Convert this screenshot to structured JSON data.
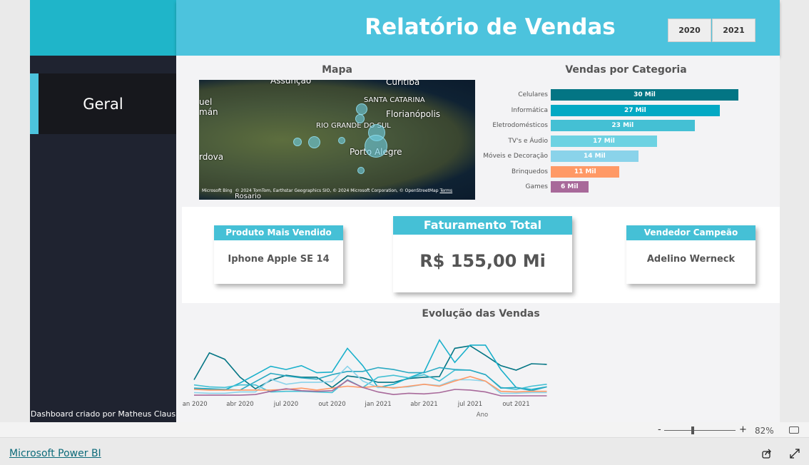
{
  "header": {
    "title": "Relatório de Vendas",
    "years": [
      "2020",
      "2021"
    ]
  },
  "sidebar": {
    "nav": [
      {
        "label": "Geral",
        "active": true
      }
    ],
    "credit": "Dashboard criado por Matheus Claus"
  },
  "map": {
    "title": "Mapa",
    "labels": [
      "Assunção",
      "Curitiba",
      "SANTA CATARINA",
      "Florianópolis",
      "RIO GRANDE DO SUL",
      "Porto Alegre",
      "uel",
      "mán",
      "rdova",
      "Rosario"
    ],
    "attribution": "© 2024 TomTom, Earthstar Geographics SIO, © 2024 Microsoft Corporation, © OpenStreetMap",
    "terms": "Terms",
    "brand": "Microsoft Bing"
  },
  "categories_chart": {
    "title": "Vendas por Categoria"
  },
  "kpis": {
    "produto": {
      "title": "Produto Mais Vendido",
      "value": "Iphone Apple SE 14"
    },
    "faturamento": {
      "title": "Faturamento Total",
      "value": "R$ 155,00 Mi"
    },
    "vendedor": {
      "title": "Vendedor Campeão",
      "value": "Adelino Werneck"
    }
  },
  "line_chart": {
    "title": "Evolução das Vendas"
  },
  "chart_data": [
    {
      "type": "bar",
      "orientation": "horizontal",
      "title": "Vendas por Categoria",
      "categories": [
        "Celulares",
        "Informática",
        "Eletrodomésticos",
        "TV's e Áudio",
        "Móveis e Decoração",
        "Brinquedos",
        "Games"
      ],
      "values": [
        30,
        27,
        23,
        17,
        14,
        11,
        6
      ],
      "data_labels": [
        "30 Mil",
        "27 Mil",
        "23 Mil",
        "17 Mil",
        "14 Mil",
        "11 Mil",
        "6 Mil"
      ],
      "colors": [
        "#037584",
        "#03a9c4",
        "#44c0d4",
        "#6dd2e2",
        "#8ad3ea",
        "#ff9966",
        "#a8699a"
      ],
      "unit": "Mil"
    },
    {
      "type": "line",
      "title": "Evolução das Vendas",
      "xlabel": "Ano",
      "x_ticks": [
        "jan 2020",
        "abr 2020",
        "jul 2020",
        "out 2020",
        "jan 2021",
        "abr 2021",
        "jul 2021",
        "out 2021"
      ],
      "x_range": [
        "jan 2020",
        "dez 2021"
      ],
      "grid": false,
      "series": [
        {
          "color": "#037584",
          "values": [
            25,
            67,
            57,
            29,
            11,
            24,
            32,
            29,
            29,
            13,
            31,
            28,
            21,
            21,
            27,
            29,
            30,
            74,
            78,
            63,
            47,
            40,
            50,
            49
          ]
        },
        {
          "color": "#19b0cb",
          "values": [
            11,
            10,
            9,
            20,
            33,
            46,
            41,
            47,
            36,
            37,
            74,
            47,
            13,
            18,
            28,
            37,
            87,
            52,
            79,
            79,
            41,
            13,
            10,
            14
          ]
        },
        {
          "color": "#44c0d4",
          "values": [
            17,
            14,
            13,
            17,
            17,
            6,
            7,
            7,
            6,
            5,
            25,
            13,
            29,
            32,
            28,
            33,
            23,
            40,
            40,
            33,
            13,
            10,
            15,
            18
          ]
        },
        {
          "color": "#2aa9c2",
          "values": [
            12,
            11,
            10,
            9,
            22,
            35,
            31,
            28,
            26,
            33,
            38,
            38,
            44,
            41,
            36,
            36,
            44,
            41,
            40,
            33,
            12,
            13,
            8,
            14
          ]
        },
        {
          "color": "#8ad3ea",
          "values": [
            5,
            4,
            4,
            6,
            6,
            26,
            18,
            21,
            21,
            22,
            46,
            23,
            13,
            13,
            14,
            18,
            16,
            25,
            25,
            23,
            4,
            4,
            5,
            5
          ]
        },
        {
          "color": "#ff9966",
          "values": [
            10,
            9,
            9,
            9,
            9,
            9,
            10,
            12,
            9,
            12,
            15,
            13,
            15,
            12,
            15,
            18,
            15,
            23,
            30,
            23,
            7,
            6,
            7,
            7
          ]
        },
        {
          "color": "#a8699a",
          "values": [
            1,
            1,
            1,
            1,
            2,
            7,
            11,
            8,
            7,
            8,
            24,
            13,
            6,
            2,
            4,
            3,
            5,
            10,
            9,
            6,
            0,
            0,
            0,
            0
          ]
        }
      ]
    }
  ],
  "zoom": {
    "minus": "-",
    "plus": "+",
    "level": "82%",
    "value": 82
  },
  "footer": {
    "link": "Microsoft Power BI"
  }
}
